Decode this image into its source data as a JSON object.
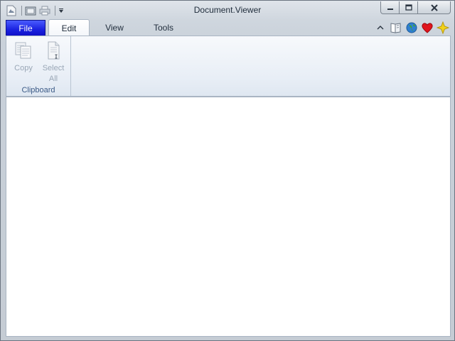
{
  "window": {
    "title": "Document.Viewer"
  },
  "quick_access": {
    "icons": [
      "app-icon",
      "open-icon",
      "print-icon",
      "customize-dropdown-icon"
    ]
  },
  "caption": {
    "icons": [
      "minimize-icon",
      "maximize-icon",
      "close-icon"
    ]
  },
  "tabs": [
    {
      "label": "File"
    },
    {
      "label": "Edit"
    },
    {
      "label": "View"
    },
    {
      "label": "Tools"
    }
  ],
  "right_icons": [
    "collapse-ribbon-icon",
    "help-book-icon",
    "globe-icon",
    "heart-icon",
    "star-icon"
  ],
  "ribbon": {
    "groups": [
      {
        "label": "Clipboard",
        "buttons": [
          {
            "label": "Copy",
            "icon": "copy-icon",
            "enabled": false
          },
          {
            "label": "Select All",
            "label_line1": "Select",
            "label_line2": "All",
            "icon": "select-all-icon",
            "enabled": false
          }
        ]
      }
    ]
  },
  "colors": {
    "file_tab": "#1a22e0",
    "group_label": "#3b5a86",
    "disabled_text": "#9aa7b6",
    "heart": "#e0141c",
    "star": "#f2d21a"
  }
}
